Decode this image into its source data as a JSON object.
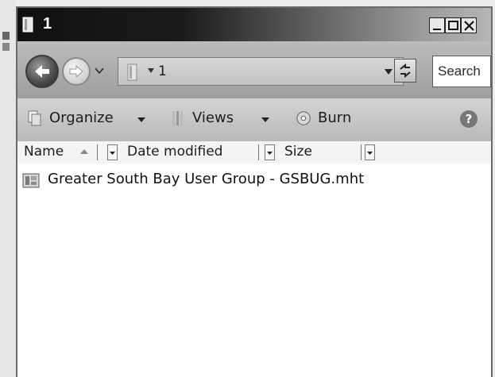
{
  "window": {
    "title": "1",
    "controls": {
      "minimize": "minimize",
      "maximize": "maximize",
      "close": "close"
    }
  },
  "navbar": {
    "address": "1",
    "search_placeholder": "Search"
  },
  "toolbar": {
    "organize_label": "Organize",
    "views_label": "Views",
    "burn_label": "Burn"
  },
  "columns": [
    {
      "label": "Name"
    },
    {
      "label": "Date modified"
    },
    {
      "label": "Size"
    }
  ],
  "files": [
    {
      "name": "Greater South Bay User Group - GSBUG.mht"
    }
  ],
  "icons": {
    "back": "back-arrow-icon",
    "forward": "forward-arrow-icon",
    "folder": "folder-icon",
    "refresh": "refresh-icon",
    "organize": "organize-icon",
    "views": "views-icon",
    "burn": "burn-disc-icon",
    "help": "help-icon",
    "file": "mht-file-icon"
  }
}
